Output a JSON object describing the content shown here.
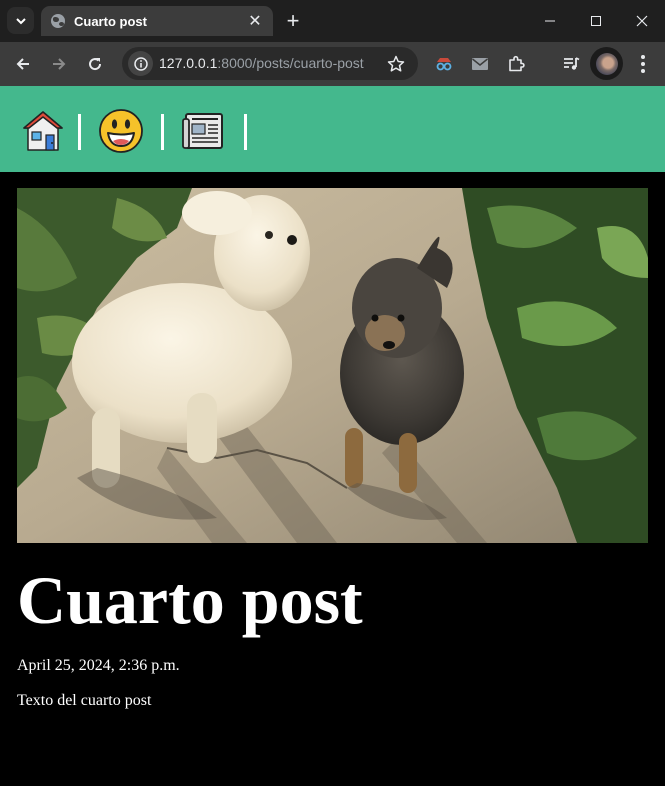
{
  "browser": {
    "tab_title": "Cuarto post",
    "tab_close": "✕",
    "new_tab": "+",
    "url_host": "127.0.0.1",
    "url_rest": ":8000/posts/cuarto-post"
  },
  "icons": {
    "nav": [
      "home-icon",
      "smiley-icon",
      "newspaper-icon"
    ]
  },
  "colors": {
    "nav_bar": "#44b88d",
    "page_background": "#000000",
    "text": "#ffffff"
  },
  "post": {
    "title": "Cuarto post",
    "date": "April 25, 2024, 2:36 p.m.",
    "body": "Texto del cuarto post",
    "image_subject": "two-dogs-photo"
  }
}
